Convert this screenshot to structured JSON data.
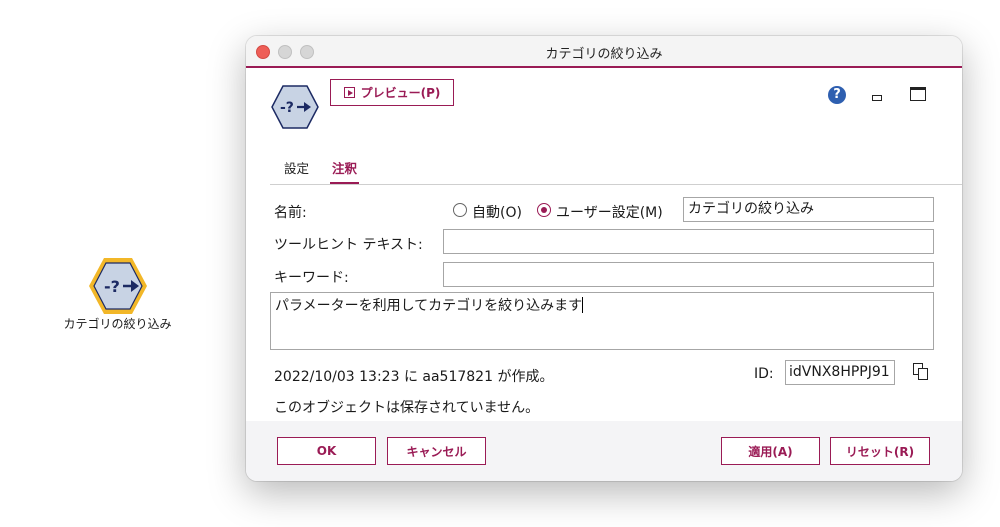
{
  "canvas": {
    "node_label": "カテゴリの絞り込み"
  },
  "window": {
    "title": "カテゴリの絞り込み",
    "preview_label": "プレビュー(P)",
    "help_glyph": "?"
  },
  "tabs": [
    {
      "label": "設定",
      "active": false
    },
    {
      "label": "注釈",
      "active": true
    }
  ],
  "form": {
    "name_label": "名前:",
    "radio_auto_label": "自動(O)",
    "radio_custom_label": "ユーザー設定(M)",
    "selected_radio": "custom",
    "name_value": "カテゴリの絞り込み",
    "tooltip_label": "ツールヒント テキスト:",
    "tooltip_value": "",
    "keyword_label": "キーワード:",
    "keyword_value": "",
    "annotation_text": "パラメーターを利用してカテゴリを絞り込みます",
    "created_text": "2022/10/03 13:23 に aa517821 が作成。",
    "id_label": "ID:",
    "id_value": "idVNX8HPPJ91",
    "unsaved_text": "このオブジェクトは保存されていません。"
  },
  "buttons": {
    "ok": "OK",
    "cancel": "キャンセル",
    "apply": "適用(A)",
    "reset": "リセット(R)"
  },
  "colors": {
    "accent": "#9a1b55",
    "node_ring": "#f2b728",
    "node_fill": "#c8d3e4",
    "node_glyph": "#1c2a63",
    "help_blue": "#2e5fb0"
  },
  "icons": {
    "node": "filter-category-node-icon",
    "preview": "play-icon",
    "help": "help-icon",
    "minimize": "minimize-icon",
    "maximize": "maximize-icon",
    "copy": "copy-icon"
  }
}
